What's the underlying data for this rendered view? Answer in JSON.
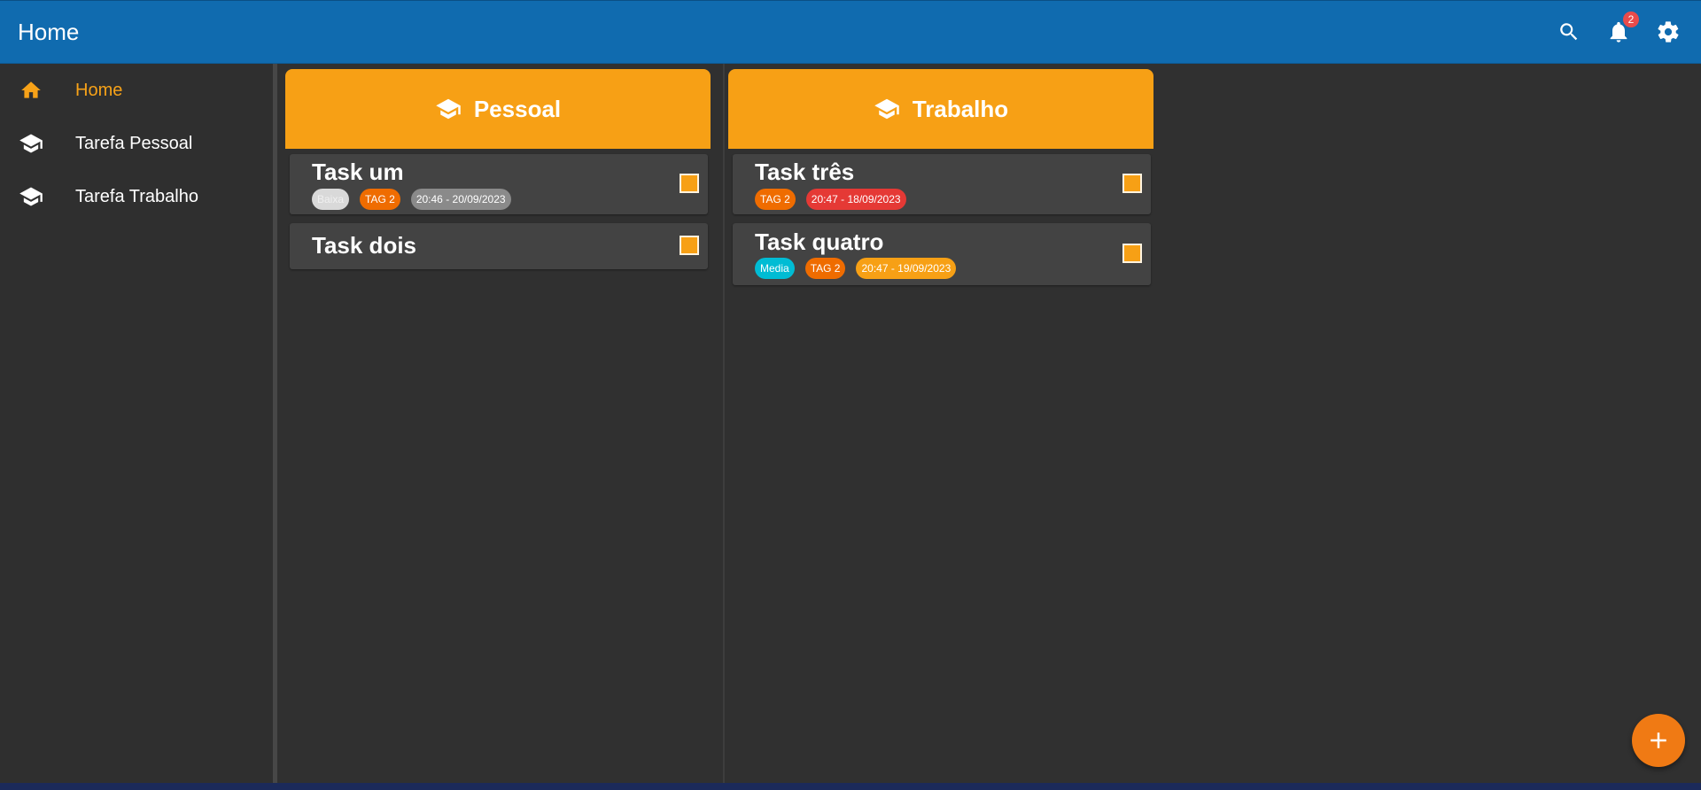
{
  "appbar": {
    "title": "Home",
    "notifications_count": "2",
    "icons": [
      "search-icon",
      "bell-icon",
      "gear-icon"
    ]
  },
  "sidebar": {
    "items": [
      {
        "label": "Home",
        "icon": "home-icon",
        "active": true
      },
      {
        "label": "Tarefa Pessoal",
        "icon": "graduation-cap-icon",
        "active": false
      },
      {
        "label": "Tarefa Trabalho",
        "icon": "graduation-cap-icon",
        "active": false
      }
    ]
  },
  "columns": [
    {
      "title": "Pessoal",
      "icon": "graduation-cap-icon",
      "cards": [
        {
          "title": "Task um",
          "tags": [
            {
              "label": "Baixa",
              "color": "#d9d9d9"
            },
            {
              "label": "TAG 2",
              "color": "#ef6c00"
            },
            {
              "label": "20:46 - 20/09/2023",
              "color": "#8a8a8a"
            }
          ]
        },
        {
          "title": "Task dois",
          "tags": []
        }
      ]
    },
    {
      "title": "Trabalho",
      "icon": "graduation-cap-icon",
      "cards": [
        {
          "title": "Task três",
          "tags": [
            {
              "label": "TAG 2",
              "color": "#ef6c00"
            },
            {
              "label": "20:47 - 18/09/2023",
              "color": "#e53935"
            }
          ]
        },
        {
          "title": "Task quatro",
          "tags": [
            {
              "label": "Media",
              "color": "#00bcd4"
            },
            {
              "label": "TAG 2",
              "color": "#ef6c00"
            },
            {
              "label": "20:47 - 19/09/2023",
              "color": "#f7a015"
            }
          ]
        }
      ]
    }
  ],
  "colors": {
    "appbar": "#106baf",
    "accent": "#f7a015",
    "background": "#303030",
    "card": "#434343",
    "fab": "#f07a14"
  },
  "fab": {
    "icon": "plus-icon"
  }
}
